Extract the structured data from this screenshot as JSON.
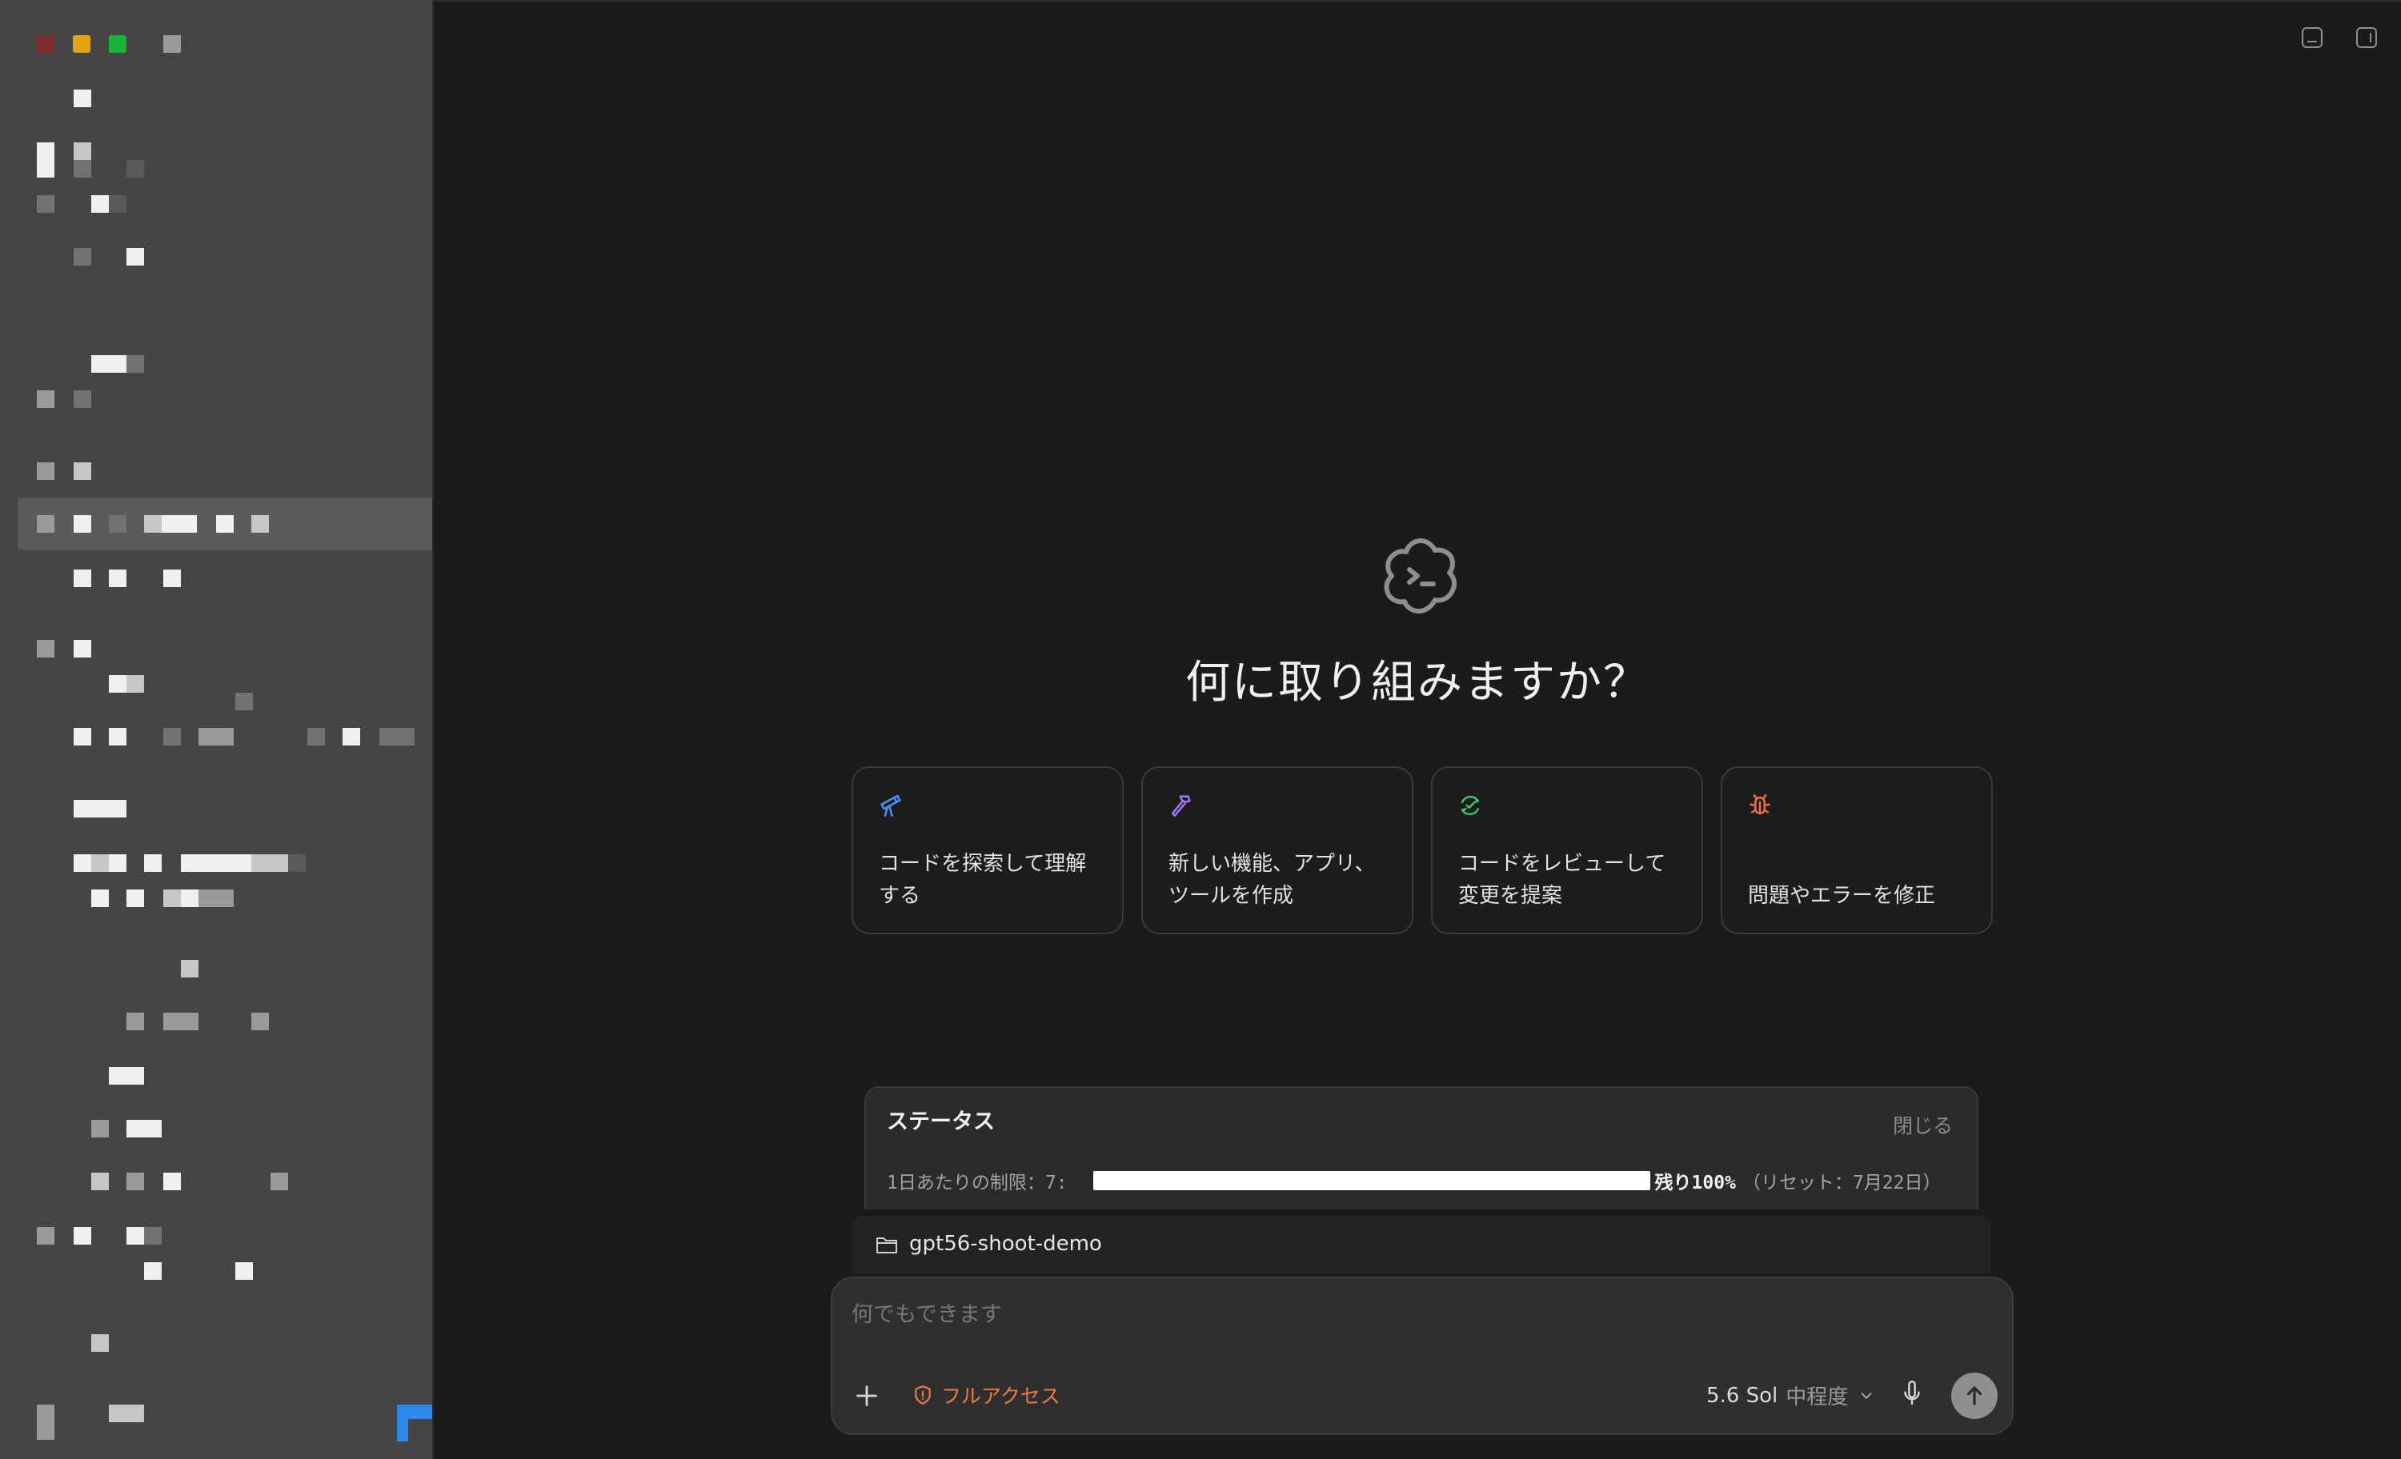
{
  "sidebar": {
    "traffic_lights": {
      "close_color": "#7d2d2d",
      "minimize_color": "#e2a413",
      "maximize_color": "#17b43a"
    },
    "content": "pixelated / redacted"
  },
  "window": {
    "controls": [
      "panel-bottom-icon",
      "panel-right-icon"
    ]
  },
  "main": {
    "headline": "何に取り組みますか？",
    "cards": [
      {
        "icon": "telescope-icon",
        "icon_color": "#4a90f7",
        "label": "コードを探索して理解する"
      },
      {
        "icon": "hammer-icon",
        "icon_color": "#a274f5",
        "label": "新しい機能、アプリ、ツールを作成"
      },
      {
        "icon": "review-icon",
        "icon_color": "#3fc06a",
        "label": "コードをレビューして変更を提案"
      },
      {
        "icon": "bug-icon",
        "icon_color": "#ef6a4a",
        "label": "問題やエラーを修正"
      }
    ]
  },
  "status": {
    "title": "ステータス",
    "close_label": "閉じる",
    "limit_label": "1日あたりの制限：7:",
    "remaining": "残り100%",
    "remaining_fraction": 1.0,
    "reset": "（リセット：7月22日）"
  },
  "project": {
    "name": "gpt56-shoot-demo",
    "icon": "folder-icon"
  },
  "composer": {
    "placeholder": "何でもできます",
    "access_label": "フルアクセス",
    "access_color": "#ee7a45",
    "model": "5.6 Sol",
    "effort": "中程度"
  }
}
